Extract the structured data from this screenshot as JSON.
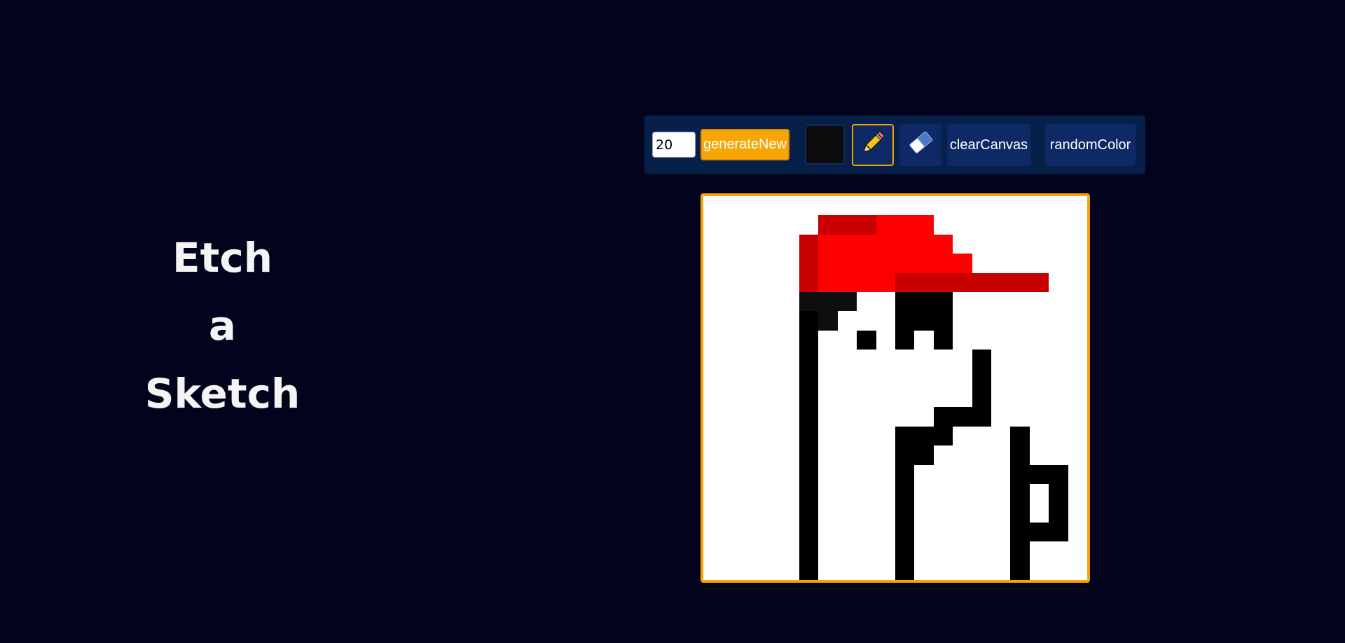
{
  "title": {
    "line1": "Etch",
    "line2": "a",
    "line3": "Sketch"
  },
  "toolbar": {
    "grid_size_value": "20",
    "generate_label": "generateNew",
    "current_color": "#0c0c0e",
    "pencil_icon": "pencil-icon",
    "eraser_icon": "eraser-icon",
    "clear_label": "clearCanvas",
    "random_label": "randomColor",
    "accent_color": "#f8a508",
    "button_color": "#0d2a66"
  },
  "canvas": {
    "grid_size": 20,
    "border_color": "#f6a20b",
    "background": "#ffffff",
    "palette": {
      "K": "#000000",
      "D": "#0e0e0e",
      "d": "#c80000",
      "R": "#ff0000"
    },
    "grid": [
      "....................",
      "......dddRRR........",
      ".....dRRRRRRR.......",
      ".....dRRRRRRRR......",
      ".....dRRRRdddddddd..",
      ".....DDD..KKK.......",
      ".....KD...KKK.......",
      ".....K..K.K.K.......",
      ".....K........K.....",
      ".....K........K.....",
      ".....K........K.....",
      ".....K......KKK.....",
      ".....K....KKK...K...",
      ".....K....KK....K...",
      ".....K....K.....KKK.",
      ".....K....K.....K.K.",
      ".....K....K.....K.K.",
      ".....K....K.....KKK.",
      ".....K....K.....K...",
      ".....K....K.....K..."
    ]
  }
}
